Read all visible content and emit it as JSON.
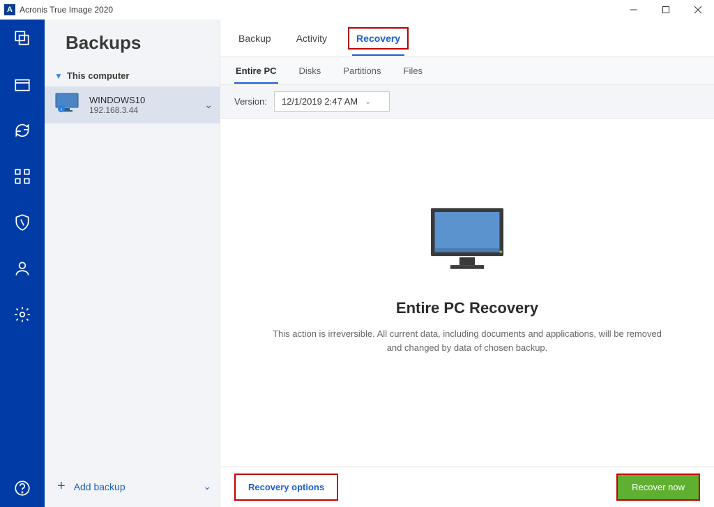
{
  "titlebar": {
    "app_name": "Acronis True Image 2020",
    "logo_letter": "A"
  },
  "sidepanel": {
    "title": "Backups",
    "group_label": "This computer",
    "backup": {
      "name": "WINDOWS10",
      "ip": "192.168.3.44"
    },
    "add_backup_label": "Add backup"
  },
  "toptabs": {
    "backup": "Backup",
    "activity": "Activity",
    "recovery": "Recovery"
  },
  "subtabs": {
    "entire_pc": "Entire PC",
    "disks": "Disks",
    "partitions": "Partitions",
    "files": "Files"
  },
  "version": {
    "label": "Version:",
    "value": "12/1/2019 2:47 AM"
  },
  "center": {
    "title": "Entire PC Recovery",
    "desc": "This action is irreversible. All current data, including documents and applications, will be removed and changed by data of chosen backup."
  },
  "footer": {
    "options_label": "Recovery options",
    "recover_label": "Recover now"
  }
}
